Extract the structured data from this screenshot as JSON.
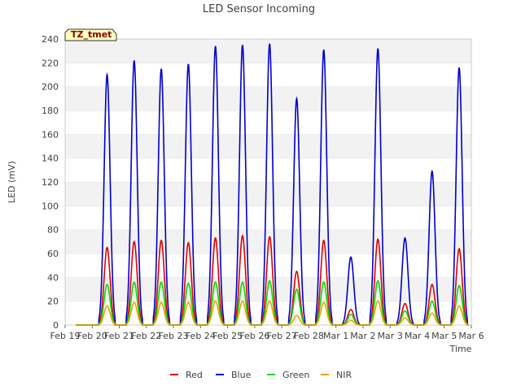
{
  "chart_data": {
    "type": "line",
    "title": "LED Sensor Incoming",
    "xlabel": "Time",
    "ylabel": "LED (mV)",
    "ylim": [
      0,
      240
    ],
    "yticks": [
      0,
      20,
      40,
      60,
      80,
      100,
      120,
      140,
      160,
      180,
      200,
      220,
      240
    ],
    "xticks": [
      "Feb 19",
      "Feb 20",
      "Feb 21",
      "Feb 22",
      "Feb 23",
      "Feb 24",
      "Feb 25",
      "Feb 26",
      "Feb 27",
      "Feb 28",
      "Mar 1",
      "Mar 2",
      "Mar 3",
      "Mar 4",
      "Mar 5",
      "Mar 6"
    ],
    "grid": "horizontal bands",
    "legend_position": "bottom-center",
    "annotation": "TZ_tmet",
    "daily_peak_day_offset": 0.55,
    "series": [
      {
        "name": "Red",
        "color": "#e00000",
        "peaks": [
          {
            "day": 1,
            "v": 65
          },
          {
            "day": 2,
            "v": 70
          },
          {
            "day": 3,
            "v": 71
          },
          {
            "day": 4,
            "v": 69
          },
          {
            "day": 5,
            "v": 73
          },
          {
            "day": 6,
            "v": 75
          },
          {
            "day": 7,
            "v": 74
          },
          {
            "day": 8,
            "v": 45
          },
          {
            "day": 9,
            "v": 71
          },
          {
            "day": 10,
            "v": 13
          },
          {
            "day": 11,
            "v": 72
          },
          {
            "day": 12,
            "v": 18
          },
          {
            "day": 13,
            "v": 34
          },
          {
            "day": 14,
            "v": 64
          }
        ]
      },
      {
        "name": "Blue",
        "color": "#0000cc",
        "peaks": [
          {
            "day": 1,
            "v": 210
          },
          {
            "day": 2,
            "v": 222
          },
          {
            "day": 3,
            "v": 215
          },
          {
            "day": 4,
            "v": 219
          },
          {
            "day": 5,
            "v": 234
          },
          {
            "day": 6,
            "v": 235
          },
          {
            "day": 7,
            "v": 236
          },
          {
            "day": 8,
            "v": 190
          },
          {
            "day": 9,
            "v": 231
          },
          {
            "day": 10,
            "v": 57
          },
          {
            "day": 11,
            "v": 232
          },
          {
            "day": 12,
            "v": 73
          },
          {
            "day": 13,
            "v": 129
          },
          {
            "day": 14,
            "v": 216
          }
        ]
      },
      {
        "name": "Green",
        "color": "#00dd00",
        "peaks": [
          {
            "day": 1,
            "v": 34
          },
          {
            "day": 2,
            "v": 36
          },
          {
            "day": 3,
            "v": 36
          },
          {
            "day": 4,
            "v": 35
          },
          {
            "day": 5,
            "v": 36
          },
          {
            "day": 6,
            "v": 36
          },
          {
            "day": 7,
            "v": 37
          },
          {
            "day": 8,
            "v": 30
          },
          {
            "day": 9,
            "v": 36
          },
          {
            "day": 10,
            "v": 9
          },
          {
            "day": 11,
            "v": 37
          },
          {
            "day": 12,
            "v": 12
          },
          {
            "day": 13,
            "v": 20
          },
          {
            "day": 14,
            "v": 33
          }
        ]
      },
      {
        "name": "NIR",
        "color": "#f0a000",
        "peaks": [
          {
            "day": 1,
            "v": 16
          },
          {
            "day": 2,
            "v": 19
          },
          {
            "day": 3,
            "v": 19
          },
          {
            "day": 4,
            "v": 19
          },
          {
            "day": 5,
            "v": 20
          },
          {
            "day": 6,
            "v": 20
          },
          {
            "day": 7,
            "v": 20
          },
          {
            "day": 8,
            "v": 8
          },
          {
            "day": 9,
            "v": 19
          },
          {
            "day": 10,
            "v": 4
          },
          {
            "day": 11,
            "v": 20
          },
          {
            "day": 12,
            "v": 6
          },
          {
            "day": 13,
            "v": 10
          },
          {
            "day": 14,
            "v": 16
          }
        ]
      }
    ]
  }
}
